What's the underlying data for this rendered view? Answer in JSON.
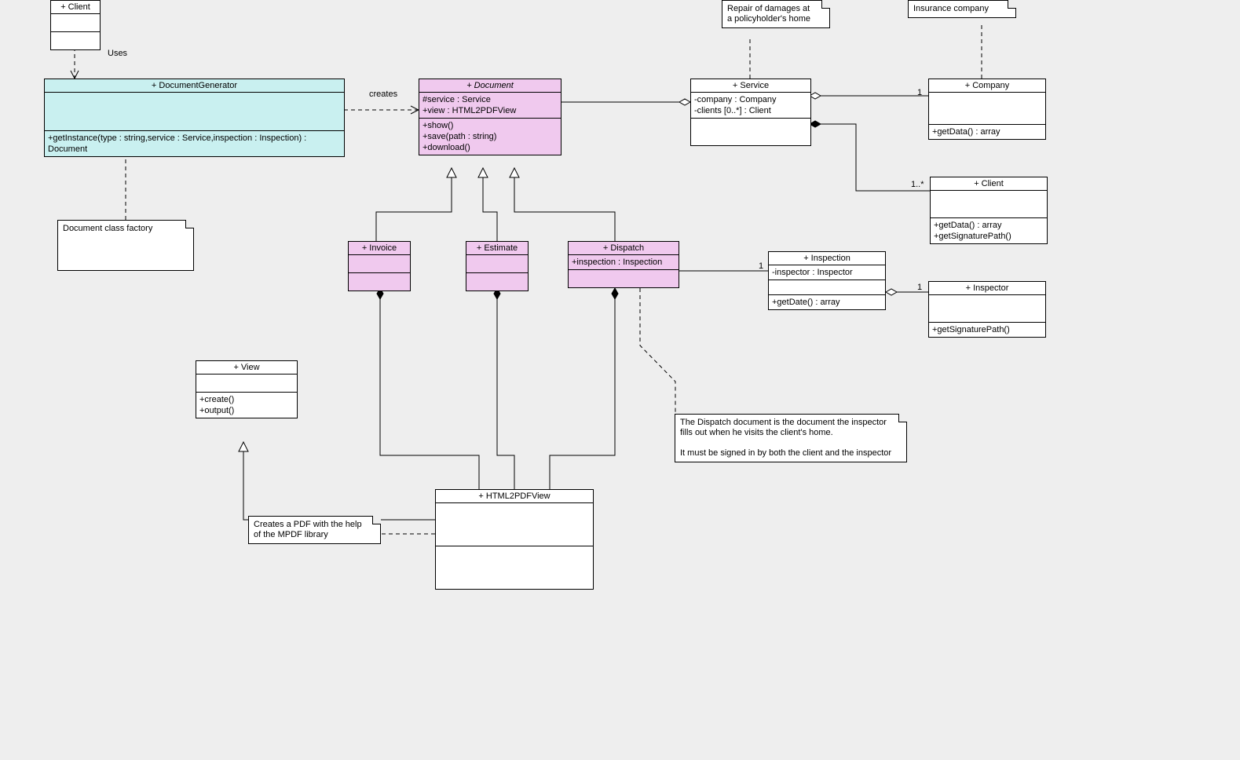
{
  "classes": {
    "clientTop": {
      "title": "+ Client"
    },
    "documentGenerator": {
      "title": "+ DocumentGenerator",
      "op1": "+getInstance(type : string,service : Service,inspection : Inspection) : Document"
    },
    "document": {
      "title": "+ Document",
      "attr1": "#service : Service",
      "attr2": "+view : HTML2PDFView",
      "op1": "+show()",
      "op2": "+save(path : string)",
      "op3": "+download()"
    },
    "service": {
      "title": "+ Service",
      "attr1": "-company : Company",
      "attr2": "-clients [0..*] : Client"
    },
    "company": {
      "title": "+ Company",
      "op1": "+getData() : array"
    },
    "client": {
      "title": "+ Client",
      "op1": "+getData() : array",
      "op2": "+getSignaturePath()"
    },
    "invoice": {
      "title": "+ Invoice"
    },
    "estimate": {
      "title": "+ Estimate"
    },
    "dispatch": {
      "title": "+ Dispatch",
      "attr1": "+inspection : Inspection"
    },
    "inspection": {
      "title": "+ Inspection",
      "attr1": "-inspector : Inspector",
      "op1": "+getDate() : array"
    },
    "inspector": {
      "title": "+ Inspector",
      "op1": "+getSignaturePath()"
    },
    "view": {
      "title": "+ View",
      "op1": "+create()",
      "op2": "+output()"
    },
    "html2pdfview": {
      "title": "+ HTML2PDFView"
    }
  },
  "notes": {
    "factory": "Document class factory",
    "repair": "Repair of damages at\na policyholder's home",
    "insurance": "Insurance company",
    "mpdf": "Creates a PDF with the help\nof the MPDF library",
    "dispatch": "The Dispatch document is the document the inspector\nfills out when he visits the client's home.\n\nIt must be signed in by both the client and the inspector"
  },
  "labels": {
    "uses": "Uses",
    "creates": "creates",
    "one1": "1",
    "one2": "1",
    "one3": "1",
    "oneStar": "1..*"
  }
}
